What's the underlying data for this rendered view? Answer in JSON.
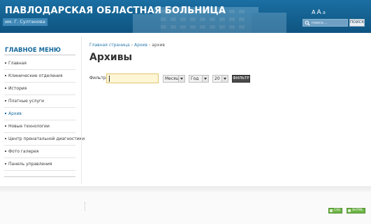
{
  "header": {
    "title": "ПАВЛОДАРСКАЯ ОБЛАСТНАЯ БОЛЬНИЦА",
    "subtitle": "им. Г. Султанова",
    "font_small": "A",
    "font_large": "A",
    "font_reset": "a",
    "search": {
      "placeholder": "поиск...",
      "button_label": "ПОИСК"
    }
  },
  "sidebar": {
    "title": "ГЛАВНОЕ МЕНЮ",
    "items": [
      {
        "label": "Главная",
        "active": false
      },
      {
        "label": "Клинические отделения",
        "active": false
      },
      {
        "label": "История",
        "active": false
      },
      {
        "label": "Платные услуги",
        "active": false
      },
      {
        "label": "Архив",
        "active": true
      },
      {
        "label": "Новые технологии",
        "active": false
      },
      {
        "label": "Центр пренатальной диагностики",
        "active": false
      },
      {
        "label": "Фото галерея",
        "active": false
      },
      {
        "label": "Панель управления",
        "active": false
      }
    ]
  },
  "breadcrumb": {
    "home": "Главная страница",
    "section": "Архив",
    "current": "архив",
    "separator": "›"
  },
  "main": {
    "title": "Архивы",
    "filter": {
      "label": "Фильтр",
      "value": "",
      "month": "Месяц",
      "year": "Год",
      "limit": "20",
      "button_label": "ФИЛЬТР"
    }
  },
  "footer": {
    "badges": [
      "CSS",
      "XHTML"
    ]
  },
  "colors": {
    "header_bg": "#13608f",
    "accent": "#16699c",
    "filter_input_bg": "#fff6d6",
    "badge_green": "#6fb547"
  }
}
